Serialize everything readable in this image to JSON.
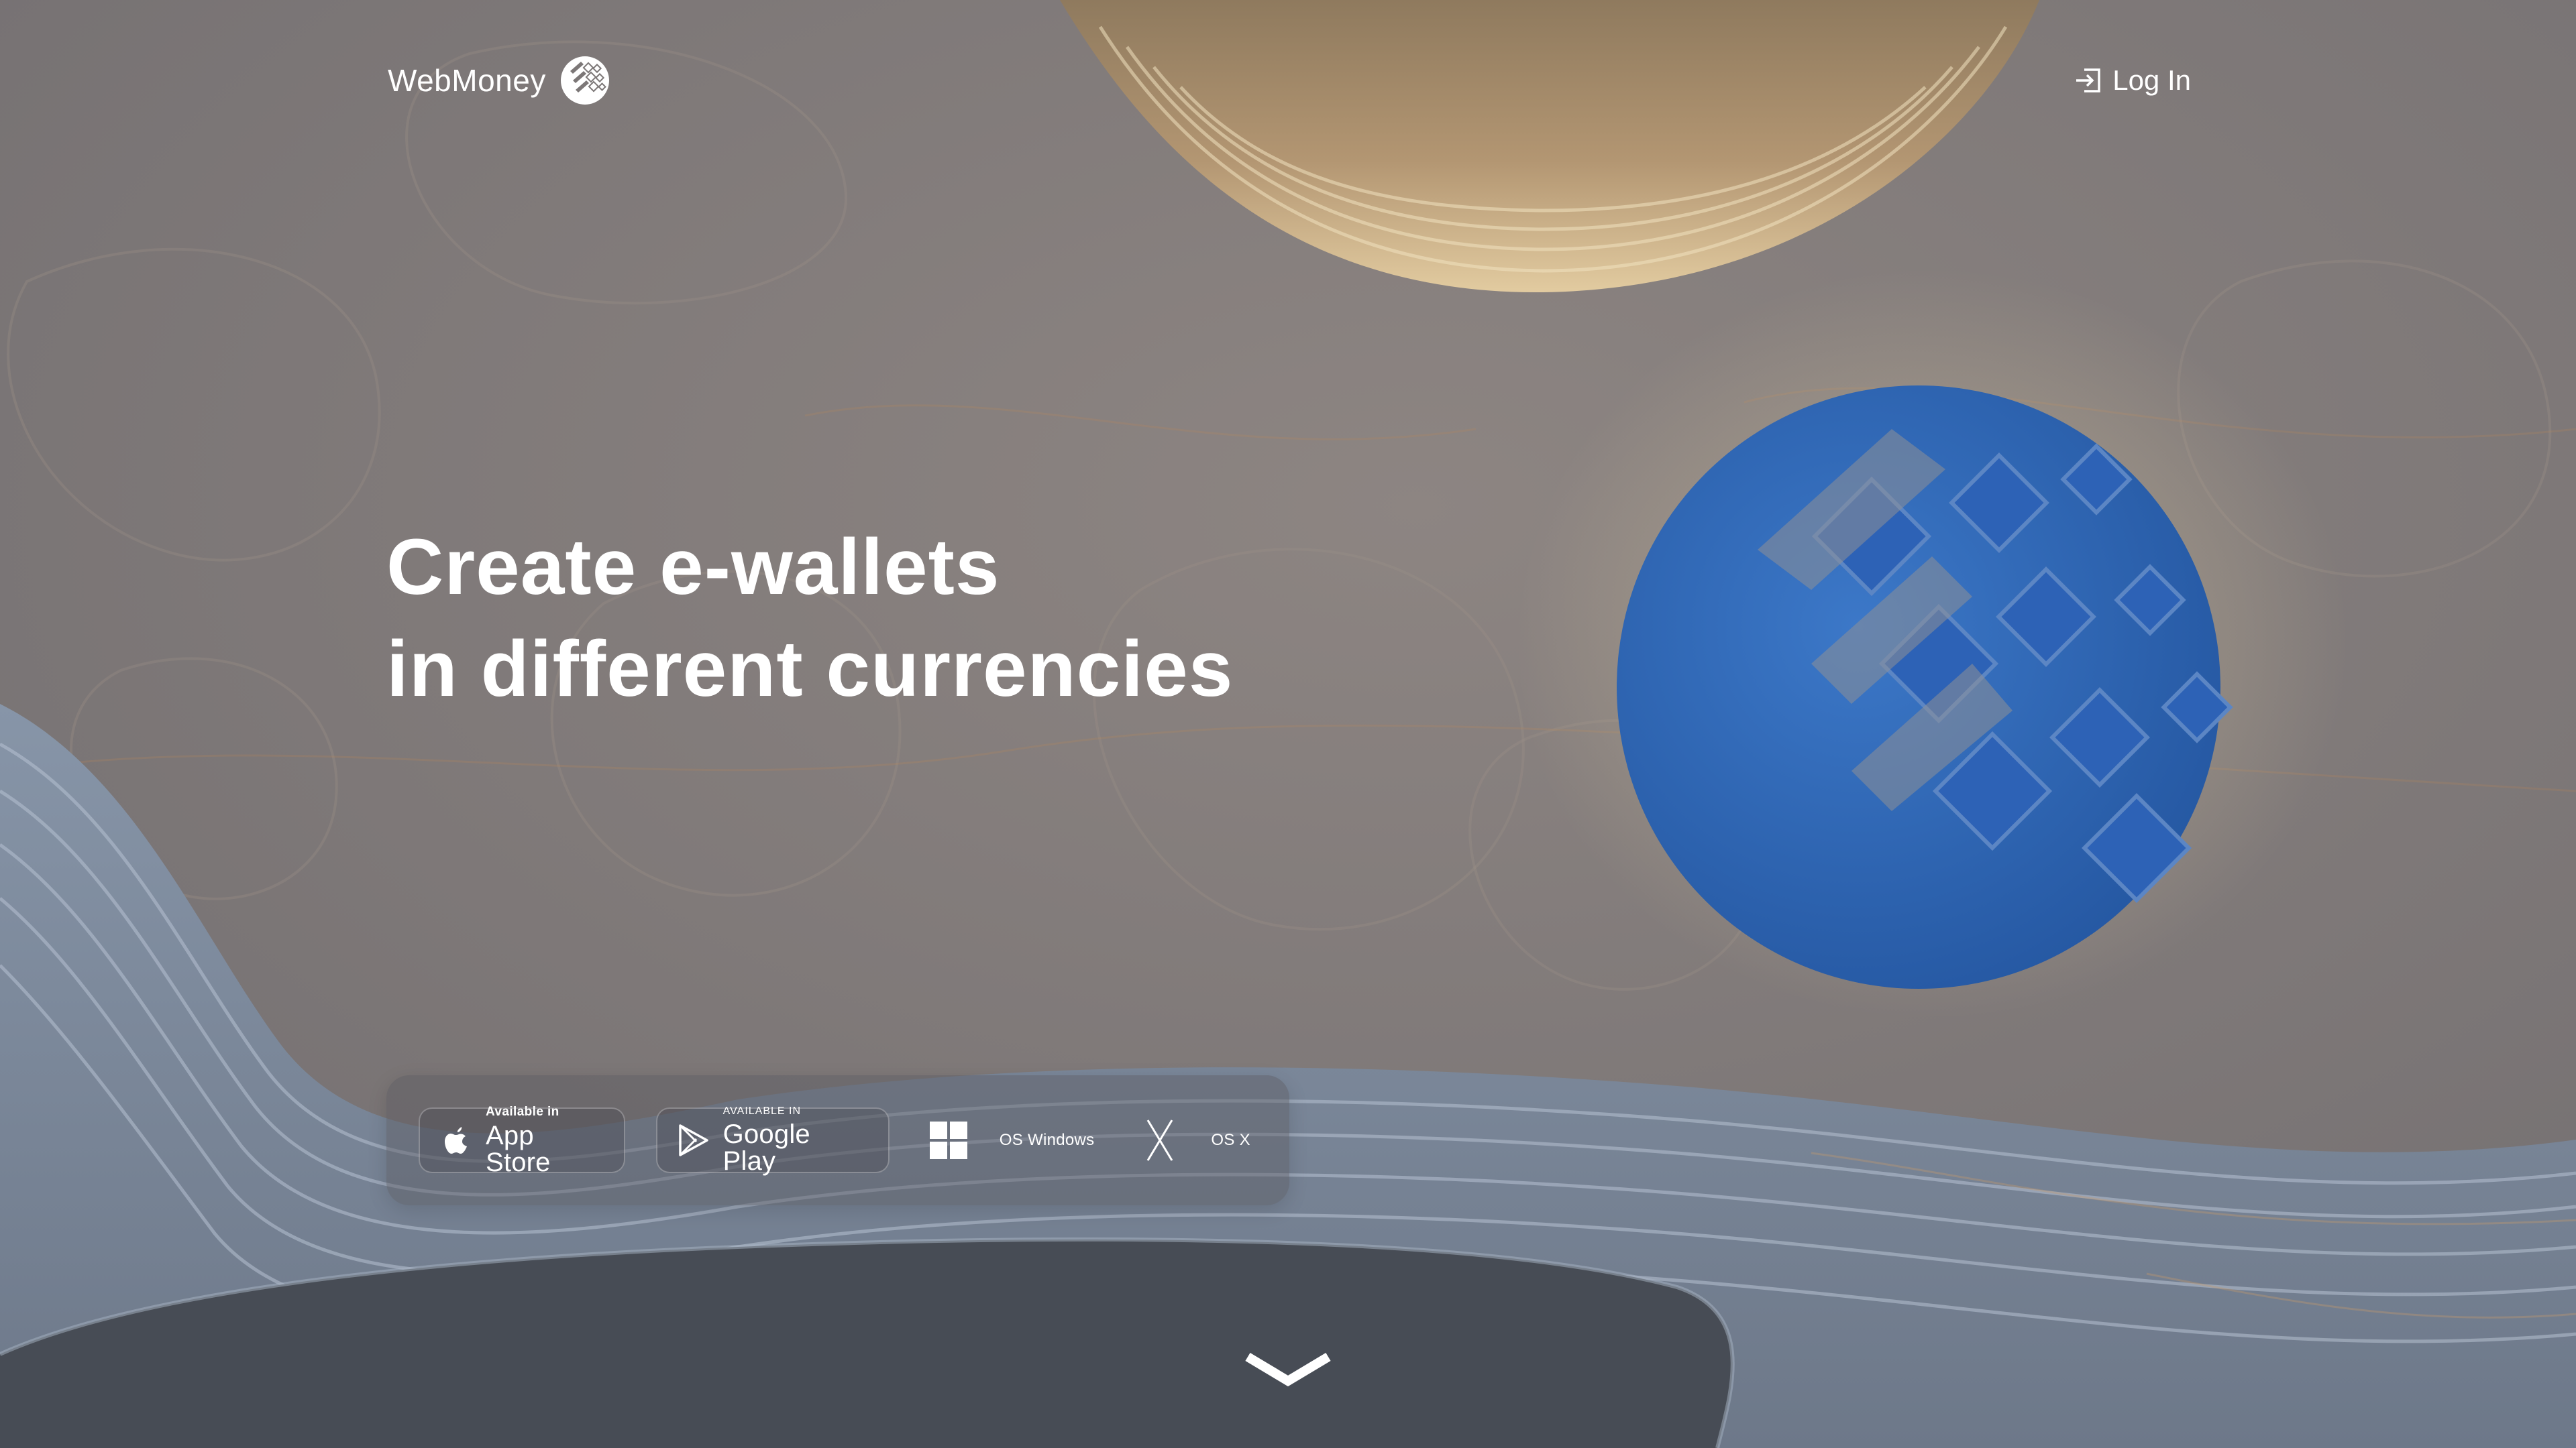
{
  "header": {
    "brand": "WebMoney",
    "login_label": "Log In"
  },
  "hero": {
    "line1": "Create e-wallets",
    "line2": "in different currencies"
  },
  "downloads": {
    "app_store": {
      "small": "Available in",
      "big": "App Store"
    },
    "google_play": {
      "small": "AVAILABLE IN",
      "big": "Google Play"
    },
    "windows": {
      "label": "OS Windows"
    },
    "osx": {
      "label": "OS X"
    }
  },
  "icons": {
    "logo": "webmoney-globe-icon",
    "login": "login-arrow-icon",
    "apple": "apple-icon",
    "play": "google-play-icon",
    "windows": "windows-icon",
    "osx": "x-icon",
    "scroll": "chevron-down-icon"
  },
  "colors": {
    "background": "#7c7777",
    "accent_blue": "#2f64b4",
    "sun_gold": "#c9a672",
    "wave_blue_gray": "#7f8c9f",
    "dark_pool": "#474c55",
    "text": "#ffffff"
  }
}
